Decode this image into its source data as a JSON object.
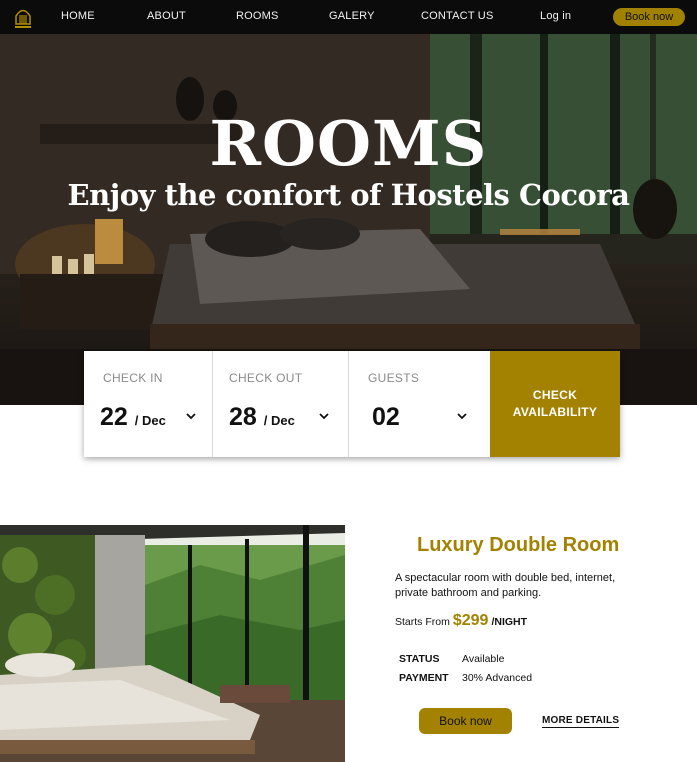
{
  "nav": {
    "links": [
      "HOME",
      "ABOUT",
      "ROOMS",
      "GALERY",
      "CONTACT US"
    ],
    "login": "Log in",
    "book": "Book now"
  },
  "hero": {
    "title": "ROOMS",
    "subtitle": "Enjoy the confort of Hostels Cocora"
  },
  "booking": {
    "check_in": {
      "label": "CHECK IN",
      "day": "22",
      "month": "/ Dec"
    },
    "check_out": {
      "label": "CHECK OUT",
      "day": "28",
      "month": "/ Dec"
    },
    "guests": {
      "label": "GUESTS",
      "value": "02"
    },
    "button": {
      "line1": "CHECK",
      "line2": "AVAILABILITY"
    }
  },
  "room": {
    "title": "Luxury Double Room",
    "description": "A spectacular room with double bed, internet, private bathroom and parking.",
    "price_prefix": "Starts From",
    "price": "$299",
    "price_unit": "/NIGHT",
    "status_label": "STATUS",
    "status_value": "Available",
    "payment_label": "PAYMENT",
    "payment_value": "30% Advanced",
    "book_button": "Book now",
    "details_link": "MORE DETAILS"
  },
  "colors": {
    "accent": "#a28200",
    "nav_bg": "#0b0b0b"
  }
}
